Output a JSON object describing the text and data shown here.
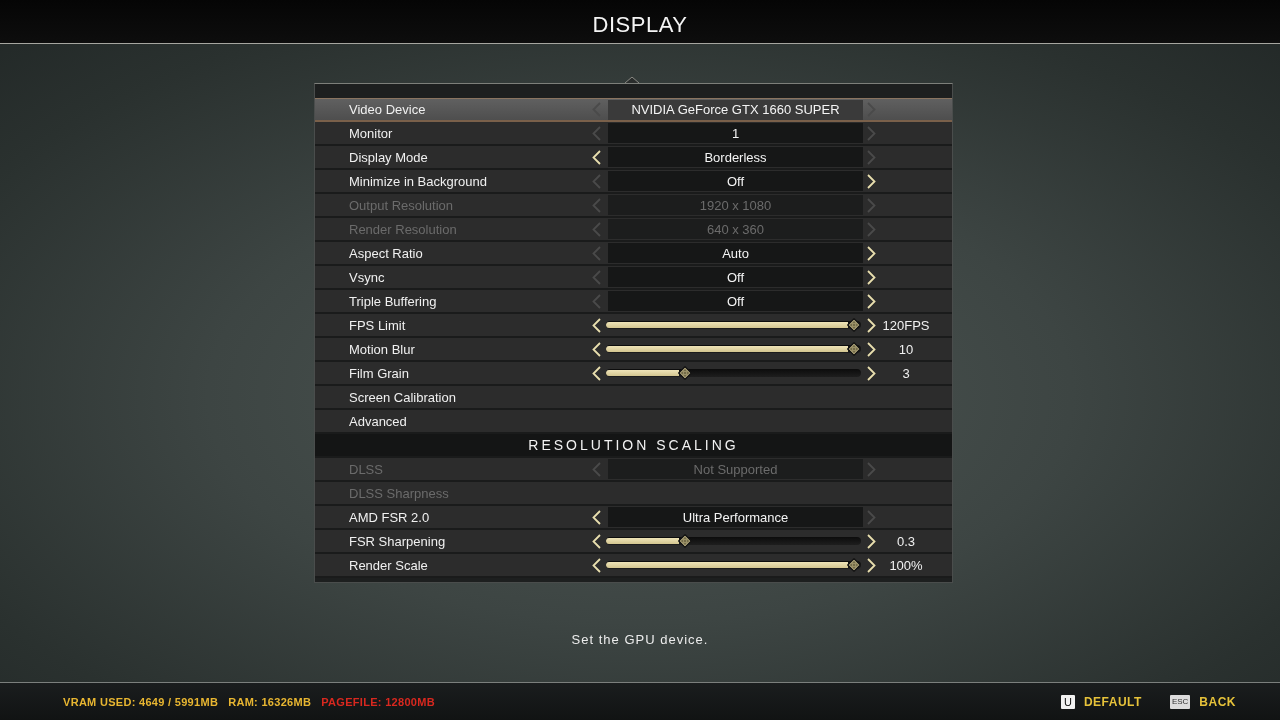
{
  "title": "DISPLAY",
  "sections": [
    {
      "rows": [
        {
          "kind": "choice",
          "label": "Video Device",
          "value": "NVIDIA GeForce GTX 1660 SUPER",
          "prev_enabled": false,
          "next_enabled": false,
          "disabled": false,
          "selected": true
        },
        {
          "kind": "choice",
          "label": "Monitor",
          "value": "1",
          "prev_enabled": false,
          "next_enabled": false,
          "disabled": false,
          "selected": false
        },
        {
          "kind": "choice",
          "label": "Display Mode",
          "value": "Borderless",
          "prev_enabled": true,
          "next_enabled": false,
          "disabled": false,
          "selected": false
        },
        {
          "kind": "choice",
          "label": "Minimize in Background",
          "value": "Off",
          "prev_enabled": false,
          "next_enabled": true,
          "disabled": false,
          "selected": false
        },
        {
          "kind": "choice",
          "label": "Output Resolution",
          "value": "1920 x 1080",
          "prev_enabled": false,
          "next_enabled": false,
          "disabled": true,
          "selected": false
        },
        {
          "kind": "choice",
          "label": "Render Resolution",
          "value": "640 x 360",
          "prev_enabled": false,
          "next_enabled": false,
          "disabled": true,
          "selected": false
        },
        {
          "kind": "choice",
          "label": "Aspect Ratio",
          "value": "Auto",
          "prev_enabled": false,
          "next_enabled": true,
          "disabled": false,
          "selected": false
        },
        {
          "kind": "choice",
          "label": "Vsync",
          "value": "Off",
          "prev_enabled": false,
          "next_enabled": true,
          "disabled": false,
          "selected": false
        },
        {
          "kind": "choice",
          "label": "Triple Buffering",
          "value": "Off",
          "prev_enabled": false,
          "next_enabled": true,
          "disabled": false,
          "selected": false
        },
        {
          "kind": "slider",
          "label": "FPS Limit",
          "level": 1,
          "reading": "120FPS",
          "prev_enabled": true,
          "next_enabled": true,
          "disabled": false,
          "selected": false
        },
        {
          "kind": "slider",
          "label": "Motion Blur",
          "level": 1,
          "reading": "10",
          "prev_enabled": true,
          "next_enabled": true,
          "disabled": false,
          "selected": false
        },
        {
          "kind": "slider",
          "label": "Film Grain",
          "level": 0.3,
          "reading": "3",
          "prev_enabled": true,
          "next_enabled": true,
          "disabled": false,
          "selected": false
        },
        {
          "kind": "action",
          "label": "Screen Calibration",
          "disabled": false,
          "selected": false
        },
        {
          "kind": "action",
          "label": "Advanced",
          "disabled": false,
          "selected": false
        }
      ]
    },
    {
      "heading": "RESOLUTION SCALING",
      "rows": [
        {
          "kind": "choice",
          "label": "DLSS",
          "value": "Not Supported",
          "prev_enabled": false,
          "next_enabled": false,
          "disabled": true,
          "selected": false
        },
        {
          "kind": "action",
          "label": "DLSS Sharpness",
          "disabled": true,
          "selected": false
        },
        {
          "kind": "choice",
          "label": "AMD FSR 2.0",
          "value": "Ultra Performance",
          "prev_enabled": true,
          "next_enabled": false,
          "disabled": false,
          "selected": false
        },
        {
          "kind": "slider",
          "label": "FSR Sharpening",
          "level": 0.3,
          "reading": "0.3",
          "prev_enabled": true,
          "next_enabled": true,
          "disabled": false,
          "selected": false
        },
        {
          "kind": "slider",
          "label": "Render Scale",
          "level": 1,
          "reading": "100%",
          "prev_enabled": true,
          "next_enabled": true,
          "disabled": false,
          "selected": false
        }
      ]
    }
  ],
  "hint": "Set the GPU device.",
  "stats": [
    {
      "text": "VRAM USED: 4649 / 5991MB",
      "color": "#e8b631"
    },
    {
      "text": "RAM: 16326MB",
      "color": "#e8b631"
    },
    {
      "text": "PAGEFILE: 12800MB",
      "color": "#d8281f"
    }
  ],
  "actions": [
    {
      "key": "U",
      "label": "DEFAULT"
    },
    {
      "key": "ESC",
      "label": "BACK"
    }
  ]
}
